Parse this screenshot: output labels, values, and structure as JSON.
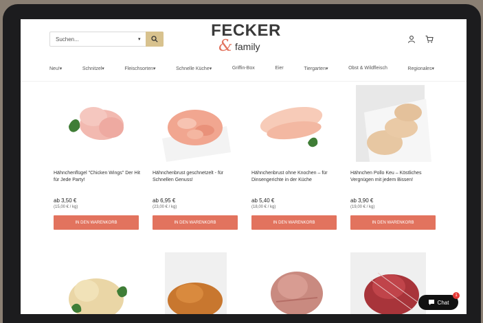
{
  "search": {
    "placeholder": "Suchen..."
  },
  "logo": {
    "main": "FECKER",
    "amp": "&",
    "sub": "family"
  },
  "nav": [
    {
      "label": "Neu!▾"
    },
    {
      "label": "Schnitzel▾"
    },
    {
      "label": "Fleischsorten▾"
    },
    {
      "label": "Schnelle Küche▾"
    },
    {
      "label": "Griffin-Box"
    },
    {
      "label": "Eier"
    },
    {
      "label": "Tiergarten▾"
    },
    {
      "label": "Obst & Wildfleisch"
    },
    {
      "label": "Regionales▾"
    }
  ],
  "products": [
    {
      "name": "Hähnchenflügel \"Chicken Wings\" Der Hit für Jede Party!",
      "price": "ab 3,50 €",
      "unit": "(15,00 € / kg)",
      "button": "IN DEN WARENKORB"
    },
    {
      "name": "Hähnchenbrust geschnetzelt - für Schnellen Genuss!",
      "price": "ab 6,95 €",
      "unit": "(23,00 € / kg)",
      "button": "IN DEN WARENKORB"
    },
    {
      "name": "Hähnchenbrust ohne Knochen – für Dinsengerichte in der Küche",
      "price": "ab 5,40 €",
      "unit": "(18,00 € / kg)",
      "button": "IN DEN WARENKORB"
    },
    {
      "name": "Hähnchen Pollo Keu – Köstliches Vergnügen mit jedem Bissen!",
      "price": "ab 3,90 €",
      "unit": "(19,00 € / kg)",
      "button": "IN DEN WARENKORB"
    }
  ],
  "chat": {
    "label": "Chat",
    "badge": "1"
  }
}
